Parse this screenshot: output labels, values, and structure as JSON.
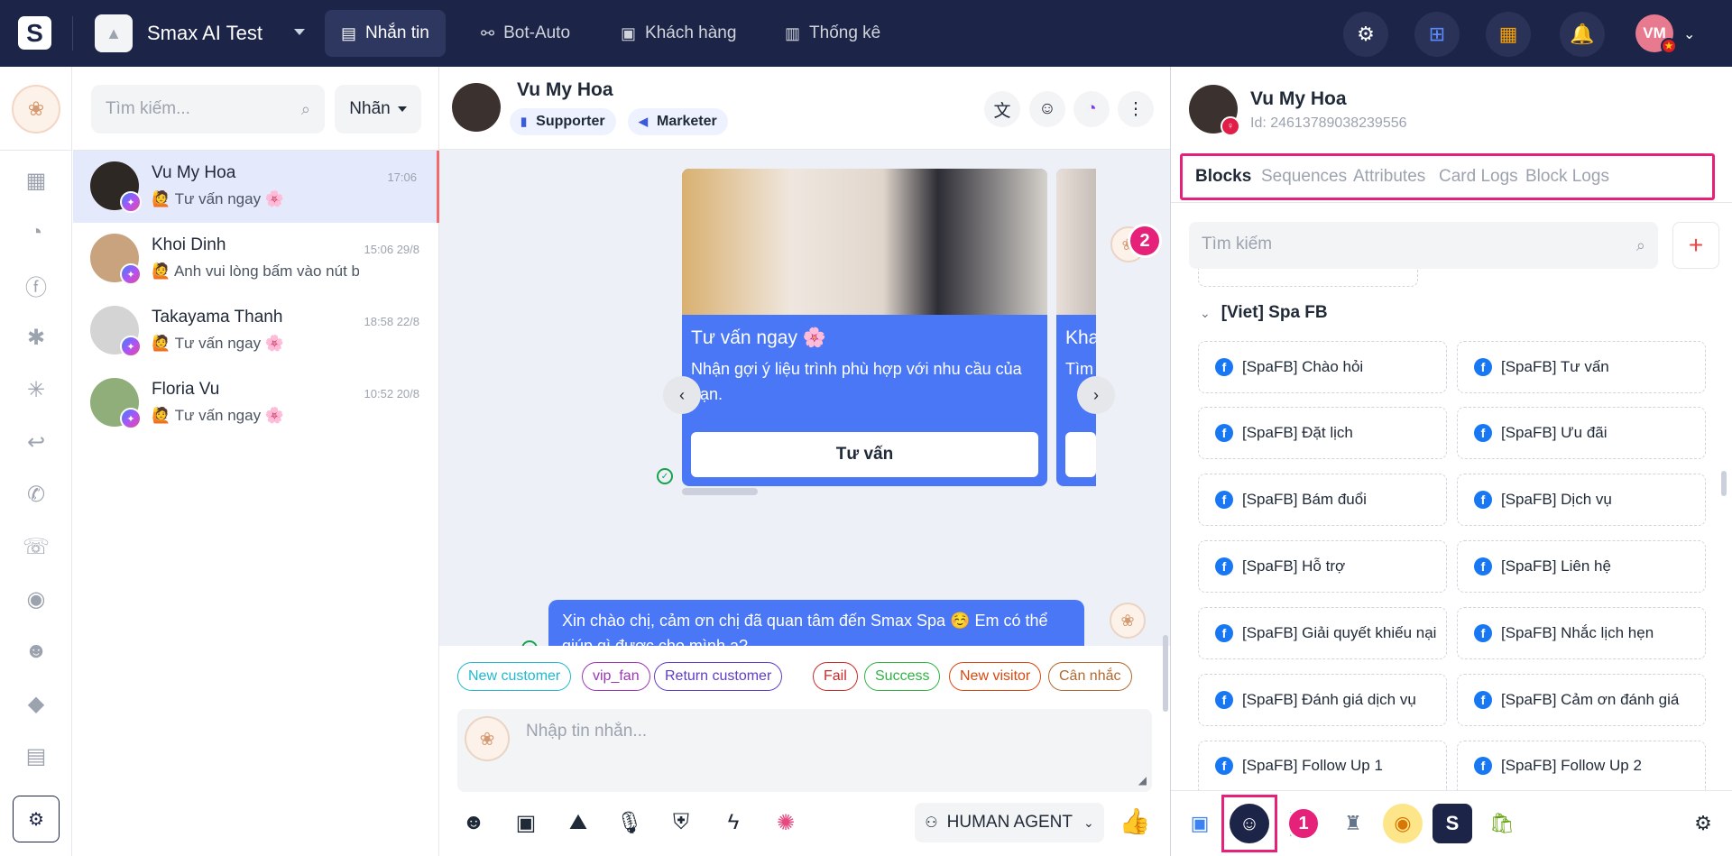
{
  "topbar": {
    "logo": "S",
    "app_name": "Smax AI Test",
    "tabs": [
      {
        "label": "Nhắn tin",
        "icon": "chat-icon"
      },
      {
        "label": "Bot-Auto",
        "icon": "bot-auto-icon"
      },
      {
        "label": "Khách hàng",
        "icon": "customer-icon"
      },
      {
        "label": "Thống kê",
        "icon": "stats-icon"
      }
    ],
    "icons": [
      "settings-icon",
      "apps-add-icon",
      "package-icon",
      "bell-icon"
    ],
    "user_initials": "VM"
  },
  "left_rail_icons": [
    "calendar-icon",
    "messenger-icon",
    "facebook-icon",
    "star-settings-icon",
    "asterisk-icon",
    "reply-icon",
    "phone-icon",
    "phone-missed-icon",
    "eye-icon",
    "users-icon",
    "tag-icon",
    "document-icon",
    "tools-icon"
  ],
  "conversation_list": {
    "search_placeholder": "Tìm kiếm...",
    "label_filter": "Nhãn",
    "items": [
      {
        "name": "Vu My Hoa",
        "time": "17:06",
        "last": "🙋 Tư vấn ngay 🌸"
      },
      {
        "name": "Khoi Dinh",
        "time": "15:06 29/8",
        "last": "🙋 Anh vui lòng bấm vào nút bên dưới"
      },
      {
        "name": "Takayama Thanh",
        "time": "18:58 22/8",
        "last": "🙋 Tư vấn ngay 🌸"
      },
      {
        "name": "Floria Vu",
        "time": "10:52 20/8",
        "last": "🙋 Tư vấn ngay 🌸"
      }
    ]
  },
  "chat": {
    "name": "Vu My Hoa",
    "tags": [
      "Supporter",
      "Marketer"
    ],
    "header_icons": [
      "translate-icon",
      "bot-icon",
      "messenger-icon",
      "more-vertical-icon"
    ],
    "card": {
      "title": "Tư vấn ngay 🌸",
      "subtitle": "Nhận gợi ý liệu trình phù hợp với nhu cầu của bạn.",
      "button": "Tư vấn"
    },
    "card2": {
      "title": "Kha",
      "subtitle": "Tìm"
    },
    "message": "Xin chào chị, cảm ơn chị đã quan tâm đến Smax Spa ☺️ Em có thể giúp gì được cho mình ạ?",
    "chips": [
      {
        "label": "New customer",
        "color": "#22b8cf"
      },
      {
        "label": "vip_fan",
        "color": "#9c36b5"
      },
      {
        "label": "Return customer",
        "color": "#5f3dc4"
      },
      {
        "label": "Fail",
        "color": "#c92a2a"
      },
      {
        "label": "Success",
        "color": "#2fb344"
      },
      {
        "label": "New visitor",
        "color": "#d9480f"
      },
      {
        "label": "Cân nhắc",
        "color": "#b0682d"
      }
    ],
    "composer_placeholder": "Nhập tin nhắn...",
    "tools": [
      "emoji-icon",
      "quick-reply-icon",
      "image-icon",
      "microphone-icon",
      "shield-icon",
      "lightning-icon",
      "ai-sparkle-icon"
    ],
    "agent_mode": "HUMAN AGENT"
  },
  "panel": {
    "name": "Vu My Hoa",
    "id": "Id: 24613789038239556",
    "tabs": [
      "Blocks",
      "Sequences",
      "Attributes",
      "Card Logs",
      "Block Logs"
    ],
    "search_placeholder": "Tìm kiếm",
    "group_name": "[Viet] Spa FB",
    "blocks": [
      "[SpaFB] Chào hỏi",
      "[SpaFB] Tư vấn",
      "[SpaFB] Đặt lịch",
      "[SpaFB] Ưu đãi",
      "[SpaFB] Bám đuổi",
      "[SpaFB] Dịch vụ",
      "[SpaFB] Hỗ trợ",
      "[SpaFB] Liên hệ",
      "[SpaFB] Giải quyết khiếu nại",
      "[SpaFB] Nhắc lịch hẹn",
      "[SpaFB] Đánh giá dịch vụ",
      "[SpaFB] Cảm ơn đánh giá",
      "[SpaFB] Follow Up 1",
      "[SpaFB] Follow Up 2"
    ],
    "badges": [
      "1",
      "2"
    ],
    "footer_icons": [
      "contact-icon",
      "bot-face-icon",
      "green-app-icon",
      "robot-icon",
      "eye-app-icon",
      "smax-icon",
      "shopify-icon",
      "settings-icon"
    ]
  }
}
